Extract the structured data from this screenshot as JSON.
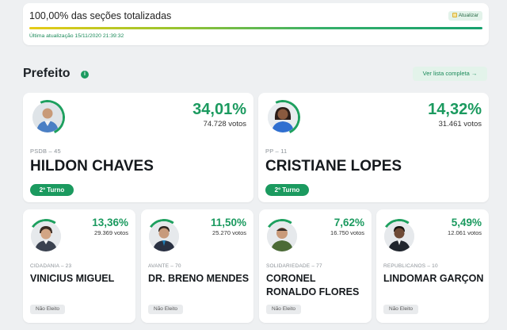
{
  "status": {
    "title": "100,00% das seções totalizadas",
    "progress": 1.0,
    "refresh_label": "Atualizar",
    "last_update": "Última atualização 15/11/2020 21:39:32"
  },
  "section": {
    "title": "Prefeito",
    "info_icon": "info-icon",
    "list_button": "Ver lista completa →"
  },
  "candidates": [
    {
      "name": "HILDON CHAVES",
      "party": "PSDB – 45",
      "pct": "34,01%",
      "votes": "74.728 votos",
      "status": "2º Turno",
      "vote_share": 0.3401
    },
    {
      "name": "CRISTIANE LOPES",
      "party": "PP – 11",
      "pct": "14,32%",
      "votes": "31.461 votos",
      "status": "2º Turno",
      "vote_share": 0.1432
    },
    {
      "name": "VINICIUS MIGUEL",
      "party": "CIDADANIA – 23",
      "pct": "13,36%",
      "votes": "29.369 votos",
      "status": "Não Eleito",
      "vote_share": 0.1336
    },
    {
      "name": "DR. BRENO MENDES",
      "party": "AVANTE – 70",
      "pct": "11,50%",
      "votes": "25.270 votos",
      "status": "Não Eleito",
      "vote_share": 0.115
    },
    {
      "name": "CORONEL RONALDO FLORES",
      "party": "SOLIDARIEDADE – 77",
      "pct": "7,62%",
      "votes": "16.750 votos",
      "status": "Não Eleito",
      "vote_share": 0.0762
    },
    {
      "name": "LINDOMAR GARÇON",
      "party": "REPUBLICANOS – 10",
      "pct": "5,49%",
      "votes": "12.061 votos",
      "status": "Não Eleito",
      "vote_share": 0.0549
    }
  ],
  "colors": {
    "accent": "#1b9a5f",
    "progress_start": "#e7cb17",
    "progress_end": "#16a06d",
    "background": "#eef0f2"
  }
}
